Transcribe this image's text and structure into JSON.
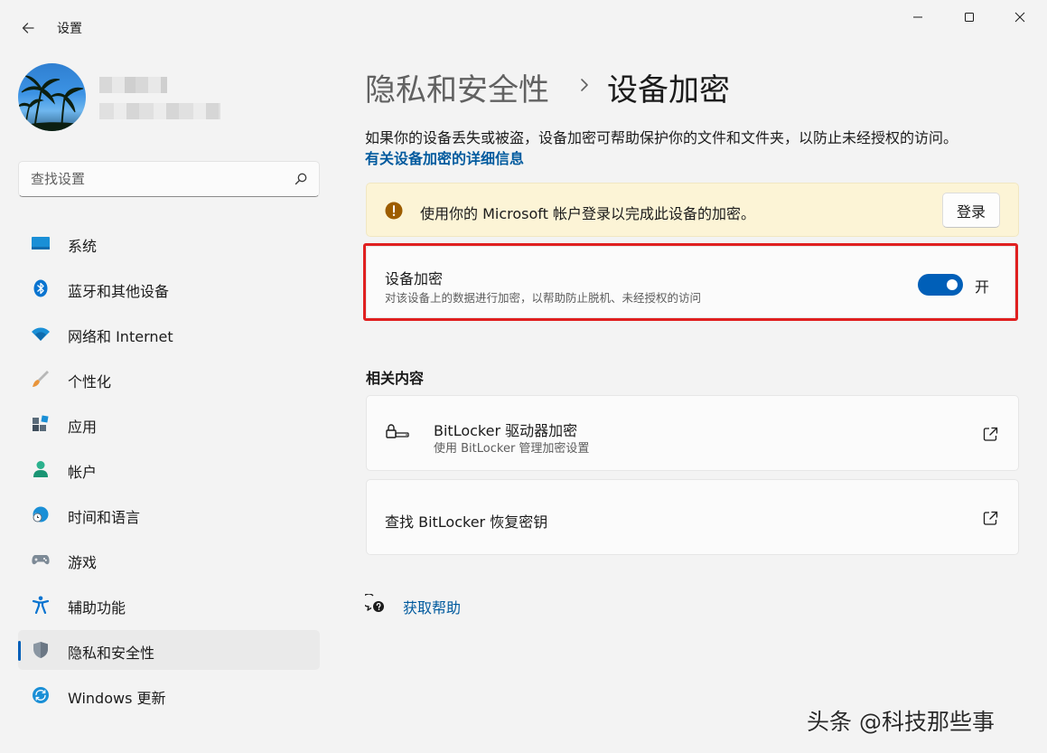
{
  "window": {
    "title": "设置"
  },
  "search": {
    "placeholder": "查找设置"
  },
  "sidebar": {
    "items": [
      {
        "label": "系统",
        "icon": "monitor-icon"
      },
      {
        "label": "蓝牙和其他设备",
        "icon": "bluetooth-icon"
      },
      {
        "label": "网络和 Internet",
        "icon": "wifi-icon"
      },
      {
        "label": "个性化",
        "icon": "brush-icon"
      },
      {
        "label": "应用",
        "icon": "apps-icon"
      },
      {
        "label": "帐户",
        "icon": "account-icon"
      },
      {
        "label": "时间和语言",
        "icon": "globe-clock-icon"
      },
      {
        "label": "游戏",
        "icon": "gamepad-icon"
      },
      {
        "label": "辅助功能",
        "icon": "accessibility-icon"
      },
      {
        "label": "隐私和安全性",
        "icon": "shield-icon",
        "active": true
      },
      {
        "label": "Windows 更新",
        "icon": "update-icon"
      }
    ]
  },
  "main": {
    "breadcrumb_parent": "隐私和安全性",
    "breadcrumb_separator": "›",
    "breadcrumb_current": "设备加密",
    "description": "如果你的设备丢失或被盗，设备加密可帮助保护你的文件和文件夹，以防止未经授权的访问。",
    "more_info_link": "有关设备加密的详细信息",
    "warning": {
      "text": "使用你的 Microsoft 帐户登录以完成此设备的加密。",
      "button": "登录"
    },
    "encryption": {
      "title": "设备加密",
      "subtitle": "对该设备上的数据进行加密，以帮助防止脱机、未经授权的访问",
      "state_label": "开",
      "enabled": true
    },
    "related_heading": "相关内容",
    "related": [
      {
        "title": "BitLocker 驱动器加密",
        "subtitle": "使用 BitLocker 管理加密设置"
      },
      {
        "title": "查找 BitLocker 恢复密钥"
      }
    ],
    "help_link": "获取帮助"
  },
  "watermark": "头条 @科技那些事",
  "colors": {
    "accent": "#005fb8",
    "link": "#005a9e",
    "warning_bg": "#fcf4d6",
    "highlight": "#e02020"
  }
}
